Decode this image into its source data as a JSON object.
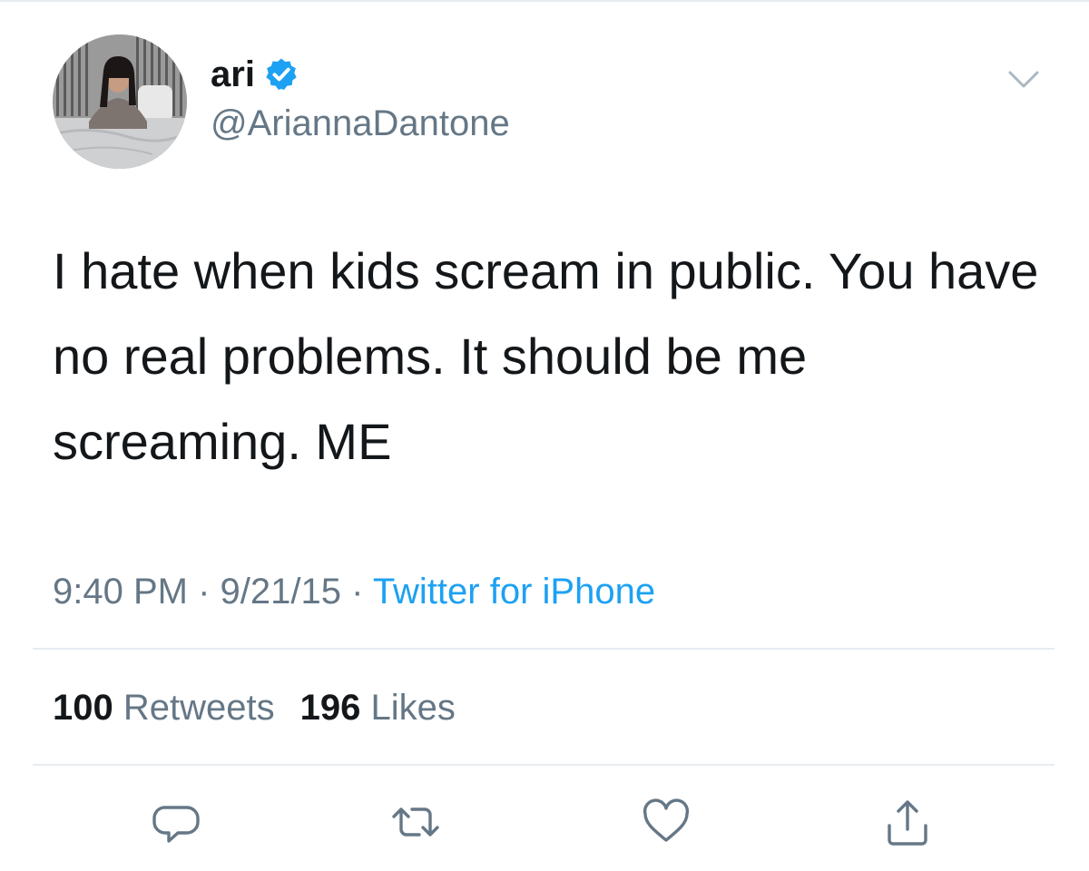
{
  "user": {
    "display_name": "ari",
    "handle": "@AriannaDantone",
    "verified": true,
    "avatar_icon": "profile-photo"
  },
  "tweet": {
    "text": "I hate when kids scream in public. You have no real problems. It should be me screaming. ME",
    "time": "9:40 PM",
    "date": "9/21/15",
    "separator": " · ",
    "source": "Twitter for iPhone"
  },
  "stats": {
    "retweets_count": "100",
    "retweets_label": "Retweets",
    "likes_count": "196",
    "likes_label": "Likes"
  },
  "actions": [
    "reply-icon",
    "retweet-icon",
    "like-icon",
    "share-icon"
  ],
  "colors": {
    "accent": "#1da1f2",
    "text": "#14171a",
    "secondary": "#657786",
    "divider": "#e6ecf0"
  }
}
